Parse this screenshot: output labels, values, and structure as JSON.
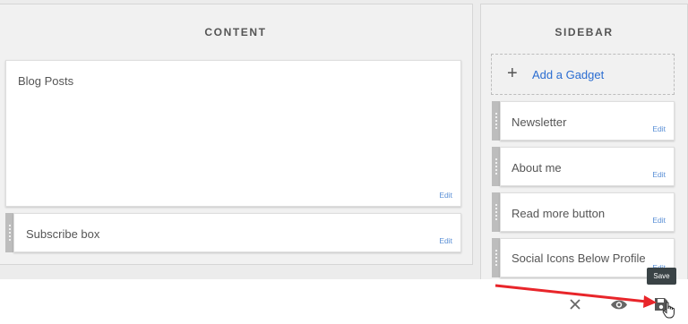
{
  "content": {
    "title": "CONTENT",
    "gadgets": [
      {
        "label": "Blog Posts",
        "edit": "Edit"
      },
      {
        "label": "Subscribe box",
        "edit": "Edit"
      }
    ]
  },
  "sidebar": {
    "title": "SIDEBAR",
    "add_gadget": "Add a Gadget",
    "gadgets": [
      {
        "label": "Newsletter",
        "edit": "Edit"
      },
      {
        "label": "About me",
        "edit": "Edit"
      },
      {
        "label": "Read more button",
        "edit": "Edit"
      },
      {
        "label": "Social Icons Below Profile",
        "edit": "Edit"
      }
    ]
  },
  "toolbar": {
    "tooltip": "Save",
    "icons": [
      "close-icon",
      "eye-icon",
      "save-icon"
    ]
  },
  "colors": {
    "link": "#2b6dd1",
    "edit": "#5a8fd6",
    "annotation_arrow": "#e8252a",
    "tooltip_bg": "#3a4346"
  }
}
